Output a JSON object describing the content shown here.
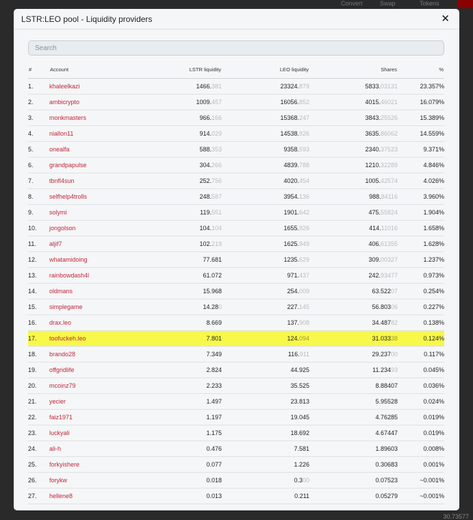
{
  "background": {
    "nav": [
      "Convert",
      "Swap",
      "Tokens"
    ],
    "bottom_value": "30.73577"
  },
  "modal": {
    "title": "LSTR:LEO pool - Liquidity providers",
    "close_glyph": "✕",
    "search_placeholder": "Search",
    "columns": [
      "#",
      "Account",
      "LSTR liquidity",
      "LEO liquidity",
      "Shares",
      "%"
    ],
    "rows": [
      {
        "n": "1.",
        "account": "khaleelkazi",
        "lstr_main": "1466.",
        "lstr_dim": "381",
        "leo_main": "23324.",
        "leo_dim": "879",
        "shares_main": "5833.",
        "shares_dim": "03131",
        "pct": "23.357%"
      },
      {
        "n": "2.",
        "account": "ambicrypto",
        "lstr_main": "1009.",
        "lstr_dim": "457",
        "leo_main": "16056.",
        "leo_dim": "852",
        "shares_main": "4015.",
        "shares_dim": "46021",
        "pct": "16.079%"
      },
      {
        "n": "3.",
        "account": "monkmasters",
        "lstr_main": "966.",
        "lstr_dim": "166",
        "leo_main": "15368.",
        "leo_dim": "247",
        "shares_main": "3843.",
        "shares_dim": "25526",
        "pct": "15.389%"
      },
      {
        "n": "4.",
        "account": "niallon11",
        "lstr_main": "914.",
        "lstr_dim": "029",
        "leo_main": "14538.",
        "leo_dim": "926",
        "shares_main": "3635.",
        "shares_dim": "86062",
        "pct": "14.559%"
      },
      {
        "n": "5.",
        "account": "onealfa",
        "lstr_main": "588.",
        "lstr_dim": "353",
        "leo_main": "9358.",
        "leo_dim": "593",
        "shares_main": "2340.",
        "shares_dim": "37523",
        "pct": "9.371%"
      },
      {
        "n": "6.",
        "account": "grandpapulse",
        "lstr_main": "304.",
        "lstr_dim": "266",
        "leo_main": "4839.",
        "leo_dim": "788",
        "shares_main": "1210.",
        "shares_dim": "32289",
        "pct": "4.846%"
      },
      {
        "n": "7.",
        "account": "tbnfl4sun",
        "lstr_main": "252.",
        "lstr_dim": "756",
        "leo_main": "4020.",
        "leo_dim": "454",
        "shares_main": "1005.",
        "shares_dim": "42574",
        "pct": "4.026%"
      },
      {
        "n": "8.",
        "account": "selfhelp4trolls",
        "lstr_main": "248.",
        "lstr_dim": "587",
        "leo_main": "3954.",
        "leo_dim": "136",
        "shares_main": "988.",
        "shares_dim": "84116",
        "pct": "3.960%"
      },
      {
        "n": "9.",
        "account": "solymi",
        "lstr_main": "119.",
        "lstr_dim": "551",
        "leo_main": "1901.",
        "leo_dim": "642",
        "shares_main": "475.",
        "shares_dim": "55824",
        "pct": "1.904%"
      },
      {
        "n": "10.",
        "account": "jongolson",
        "lstr_main": "104.",
        "lstr_dim": "104",
        "leo_main": "1655.",
        "leo_dim": "926",
        "shares_main": "414.",
        "shares_dim": "11016",
        "pct": "1.658%"
      },
      {
        "n": "11.",
        "account": "aljif7",
        "lstr_main": "102.",
        "lstr_dim": "219",
        "leo_main": "1625.",
        "leo_dim": "949",
        "shares_main": "406.",
        "shares_dim": "61355",
        "pct": "1.628%"
      },
      {
        "n": "12.",
        "account": "whatamidoing",
        "lstr_main": "77.681",
        "lstr_dim": "",
        "leo_main": "1235.",
        "leo_dim": "629",
        "shares_main": "309.",
        "shares_dim": "00327",
        "pct": "1.237%"
      },
      {
        "n": "13.",
        "account": "rainbowdash4l",
        "lstr_main": "61.072",
        "lstr_dim": "",
        "leo_main": "971.",
        "leo_dim": "437",
        "shares_main": "242.",
        "shares_dim": "93477",
        "pct": "0.973%"
      },
      {
        "n": "14.",
        "account": "oldmans",
        "lstr_main": "15.968",
        "lstr_dim": "",
        "leo_main": "254.",
        "leo_dim": "009",
        "shares_main": "63.522",
        "shares_dim": "07",
        "pct": "0.254%"
      },
      {
        "n": "15.",
        "account": "simplegame",
        "lstr_main": "14.28",
        "lstr_dim": "0",
        "leo_main": "227.",
        "leo_dim": "145",
        "shares_main": "56.803",
        "shares_dim": "06",
        "pct": "0.227%"
      },
      {
        "n": "16.",
        "account": "drax.leo",
        "lstr_main": "8.669",
        "lstr_dim": "",
        "leo_main": "137.",
        "leo_dim": "908",
        "shares_main": "34.487",
        "shares_dim": "82",
        "pct": "0.138%"
      },
      {
        "n": "17.",
        "account": "toofuckeh.leo",
        "lstr_main": "7.801",
        "lstr_dim": "",
        "leo_main": "124.",
        "leo_dim": "094",
        "shares_main": "31.033",
        "shares_dim": "38",
        "pct": "0.124%",
        "highlight": true
      },
      {
        "n": "18.",
        "account": "brando28",
        "lstr_main": "7.349",
        "lstr_dim": "",
        "leo_main": "116.",
        "leo_dim": "911",
        "shares_main": "29.237",
        "shares_dim": "00",
        "pct": "0.117%"
      },
      {
        "n": "19.",
        "account": "offgridlife",
        "lstr_main": "2.824",
        "lstr_dim": "",
        "leo_main": "44.925",
        "leo_dim": "",
        "shares_main": "11.234",
        "shares_dim": "93",
        "pct": "0.045%"
      },
      {
        "n": "20.",
        "account": "mcoinz79",
        "lstr_main": "2.233",
        "lstr_dim": "",
        "leo_main": "35.525",
        "leo_dim": "",
        "shares_main": "8.88407",
        "shares_dim": "",
        "pct": "0.036%"
      },
      {
        "n": "21.",
        "account": "yecier",
        "lstr_main": "1.497",
        "lstr_dim": "",
        "leo_main": "23.813",
        "leo_dim": "",
        "shares_main": "5.95528",
        "shares_dim": "",
        "pct": "0.024%"
      },
      {
        "n": "22.",
        "account": "faiz1971",
        "lstr_main": "1.197",
        "lstr_dim": "",
        "leo_main": "19.045",
        "leo_dim": "",
        "shares_main": "4.76285",
        "shares_dim": "",
        "pct": "0.019%"
      },
      {
        "n": "23.",
        "account": "luckyali",
        "lstr_main": "1.175",
        "lstr_dim": "",
        "leo_main": "18.692",
        "leo_dim": "",
        "shares_main": "4.67447",
        "shares_dim": "",
        "pct": "0.019%"
      },
      {
        "n": "24.",
        "account": "ali-h",
        "lstr_main": "0.476",
        "lstr_dim": "",
        "leo_main": "7.581",
        "leo_dim": "",
        "shares_main": "1.89603",
        "shares_dim": "",
        "pct": "0.008%"
      },
      {
        "n": "25.",
        "account": "forkyishere",
        "lstr_main": "0.077",
        "lstr_dim": "",
        "leo_main": "1.226",
        "leo_dim": "",
        "shares_main": "0.30683",
        "shares_dim": "",
        "pct": "0.001%"
      },
      {
        "n": "26.",
        "account": "forykw",
        "lstr_main": "0.018",
        "lstr_dim": "",
        "leo_main": "0.3",
        "leo_dim": "00",
        "shares_main": "0.07523",
        "shares_dim": "",
        "pct": "~0.001%"
      },
      {
        "n": "27.",
        "account": "hellene8",
        "lstr_main": "0.013",
        "lstr_dim": "",
        "leo_main": "0.211",
        "leo_dim": "",
        "shares_main": "0.05279",
        "shares_dim": "",
        "pct": "~0.001%"
      }
    ]
  }
}
